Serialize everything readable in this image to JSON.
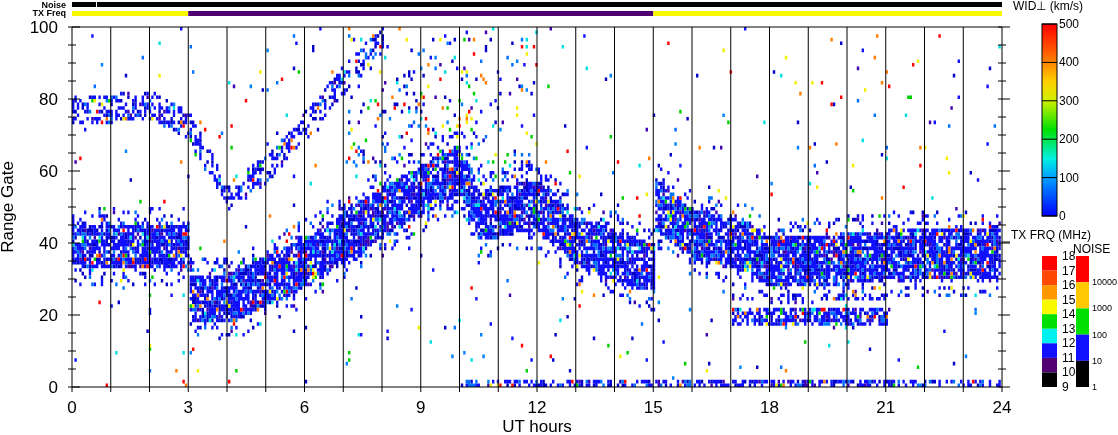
{
  "status_bars": {
    "noise_label": "Noise",
    "tx_freq_label": "TX Freq"
  },
  "plot": {
    "ylabel": "Range Gate",
    "xlabel": "UT hours",
    "yticks": [
      "100",
      "80",
      "60",
      "40",
      "20",
      "0"
    ],
    "xticks": [
      "0",
      "3",
      "6",
      "9",
      "12",
      "15",
      "18",
      "21",
      "24"
    ]
  },
  "width_legend": {
    "title": "WID⊥ (km/s)",
    "labels": [
      "500",
      "400",
      "300",
      "200",
      "100",
      "0"
    ]
  },
  "tx_freq_legend": {
    "title": "TX FRQ (MHz)",
    "labels": [
      "18",
      "17",
      "16",
      "15",
      "14",
      "13",
      "12",
      "11",
      "10",
      "9"
    ],
    "segments": [
      {
        "color": "#ff0000"
      },
      {
        "color": "#ff4800"
      },
      {
        "color": "#ff9800"
      },
      {
        "color": "#f8f800"
      },
      {
        "color": "#00e000"
      },
      {
        "color": "#00f0f0"
      },
      {
        "color": "#1010ff"
      },
      {
        "color": "#500070"
      },
      {
        "color": "#000000"
      }
    ]
  },
  "noise_legend": {
    "title": "NOISE",
    "labels": [
      "10000",
      "1000",
      "100",
      "10",
      "1"
    ],
    "segments": [
      {
        "color": "#ff0000"
      },
      {
        "color": "#ffc800"
      },
      {
        "color": "#00e000"
      },
      {
        "color": "#1010ff"
      },
      {
        "color": "#000000"
      }
    ]
  }
}
